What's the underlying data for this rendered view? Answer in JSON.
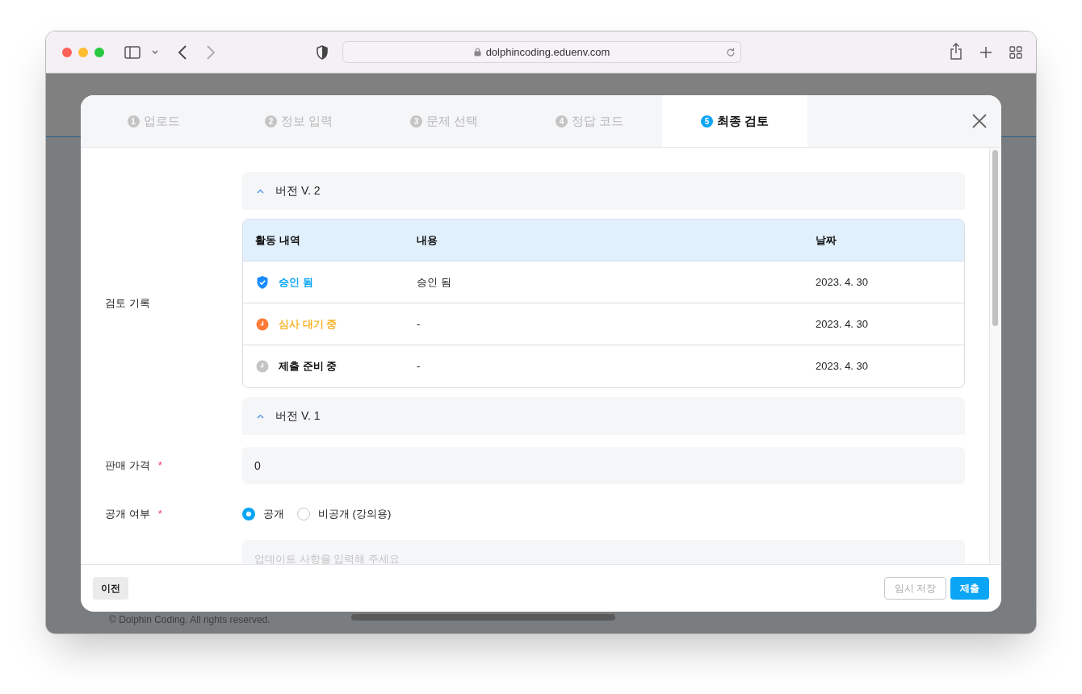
{
  "browser": {
    "url": "dolphincoding.eduenv.com"
  },
  "background_page": {
    "footer": "© Dolphin Coding. All rights reserved."
  },
  "steps": [
    {
      "number": "1",
      "label": "업로드",
      "selected": false
    },
    {
      "number": "2",
      "label": "정보 입력",
      "selected": false
    },
    {
      "number": "3",
      "label": "문제 선택",
      "selected": false
    },
    {
      "number": "4",
      "label": "정답 코드",
      "selected": false
    },
    {
      "number": "5",
      "label": "최종 검토",
      "selected": true
    }
  ],
  "review_history": {
    "label": "검토 기록",
    "versions": [
      {
        "title": "버전 V. 2",
        "expanded": true,
        "table": {
          "columns": [
            "활동 내역",
            "내용",
            "날짜"
          ],
          "rows": [
            {
              "kind": "approved",
              "activity": "승인 됨",
              "content": "승인 됨",
              "date": "2023. 4. 30"
            },
            {
              "kind": "pending",
              "activity": "심사 대기 중",
              "content": "-",
              "date": "2023. 4. 30"
            },
            {
              "kind": "preparing",
              "activity": "제출 준비 중",
              "content": "-",
              "date": "2023. 4. 30"
            }
          ]
        }
      },
      {
        "title": "버전 V. 1",
        "expanded": true
      }
    ]
  },
  "price": {
    "label": "판매 가격",
    "required_mark": "*",
    "value": "0"
  },
  "visibility": {
    "label": "공개 여부",
    "required_mark": "*",
    "options": [
      {
        "label": "공개",
        "selected": true
      },
      {
        "label": "비공개 (강의용)",
        "selected": false
      }
    ]
  },
  "update_notes": {
    "placeholder": "업데이트 사항을 입력해 주세요"
  },
  "footer": {
    "previous": {
      "label": "이전"
    },
    "save": {
      "label": "임시 저장",
      "disabled": true
    },
    "submit": {
      "label": "제출"
    }
  }
}
